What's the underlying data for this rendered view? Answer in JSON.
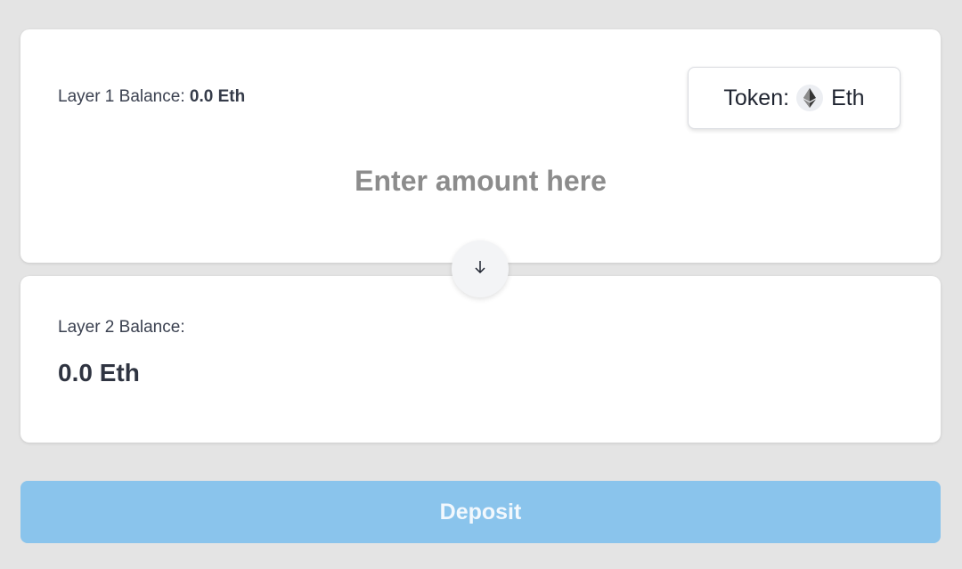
{
  "layer1": {
    "label": "Layer 1 Balance:",
    "value": "0.0 Eth"
  },
  "token": {
    "prefix": "Token:",
    "symbol": "Eth",
    "icon": "ethereum-icon"
  },
  "amount": {
    "value": "",
    "placeholder": "Enter amount here"
  },
  "swap": {
    "icon": "arrow-down-icon"
  },
  "layer2": {
    "label": "Layer 2 Balance:",
    "value": "0.0 Eth"
  },
  "deposit": {
    "label": "Deposit",
    "color": "#8ac4ec"
  }
}
